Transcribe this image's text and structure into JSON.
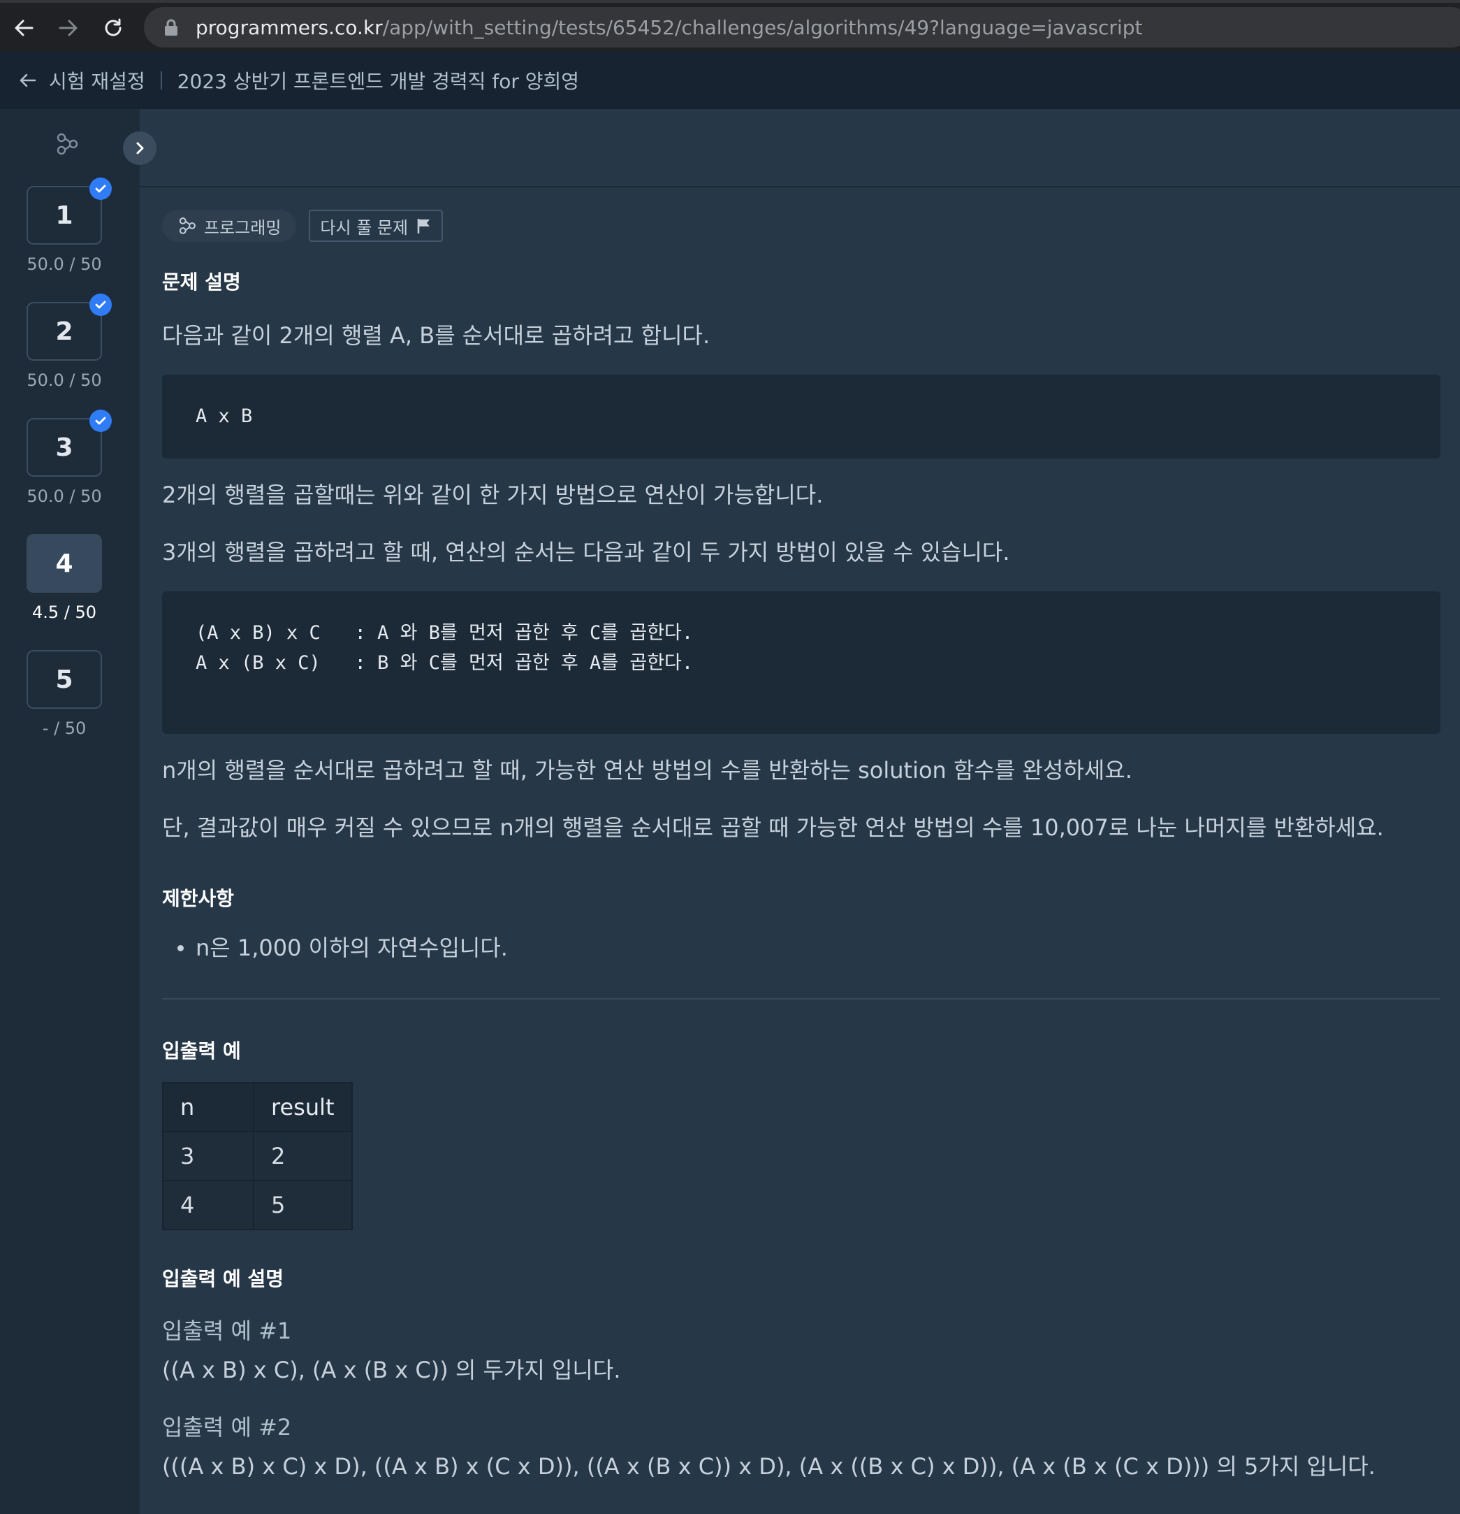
{
  "browser": {
    "url_host": "programmers.co.kr",
    "url_path": "/app/with_setting/tests/65452/challenges/algorithms/49?language=javascript"
  },
  "header": {
    "back_label": "시험 재설정",
    "exam_title": "2023 상반기 프론트엔드 개발 경력직 for 양희영"
  },
  "sidebar": {
    "questions": [
      {
        "number": "1",
        "score": "50.0 / 50",
        "completed": true
      },
      {
        "number": "2",
        "score": "50.0 / 50",
        "completed": true
      },
      {
        "number": "3",
        "score": "50.0 / 50",
        "completed": true
      },
      {
        "number": "4",
        "score": "4.5 / 50",
        "active": true
      },
      {
        "number": "5",
        "score": "- / 50"
      }
    ]
  },
  "badges": {
    "category": "프로그래밍",
    "retry": "다시 풀 문제"
  },
  "problem": {
    "heading": "문제 설명",
    "p1": "다음과 같이 2개의 행렬 A, B를 순서대로 곱하려고 합니다.",
    "code1": "A x B",
    "p2": "2개의 행렬을 곱할때는 위와 같이 한 가지 방법으로 연산이 가능합니다.",
    "p3": "3개의 행렬을 곱하려고 할 때, 연산의 순서는 다음과 같이 두 가지 방법이 있을 수 있습니다.",
    "code2_line1": "(A x B) x C   : A 와 B를 먼저 곱한 후 C를 곱한다.",
    "code2_line2": "A x (B x C)   : B 와 C를 먼저 곱한 후 A를 곱한다.",
    "p4": "n개의 행렬을 순서대로 곱하려고 할 때, 가능한 연산 방법의 수를 반환하는 solution 함수를 완성하세요.",
    "p5": "단, 결과값이 매우 커질 수 있으므로 n개의 행렬을 순서대로 곱할 때 가능한 연산 방법의 수를 10,007로 나눈 나머지를 반환하세요."
  },
  "limits": {
    "heading": "제한사항",
    "items": [
      "n은 1,000 이하의 자연수입니다."
    ]
  },
  "io": {
    "heading": "입출력 예",
    "headers": [
      "n",
      "result"
    ],
    "rows": [
      [
        "3",
        "2"
      ],
      [
        "4",
        "5"
      ]
    ]
  },
  "io_explain": {
    "heading": "입출력 예 설명",
    "ex1_title": "입출력 예 #1",
    "ex1_text": "((A x B) x C), (A x (B x C)) 의 두가지 입니다.",
    "ex2_title": "입출력 예 #2",
    "ex2_text": "(((A x B) x C) x D), ((A x B) x (C x D)), ((A x (B x C)) x D), (A x ((B x C) x D)), (A x (B x (C x D))) 의 5가지 입니다."
  }
}
